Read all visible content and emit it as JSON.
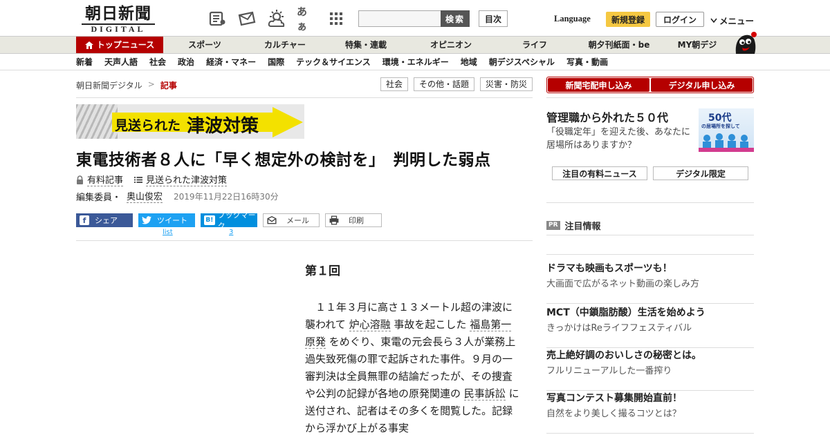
{
  "header": {
    "logo_jp": "朝日新聞",
    "logo_en": "DIGITAL",
    "icons": [
      "newspaper-icon",
      "mail-icon",
      "weather-icon",
      "font-size-icon",
      "apps-grid-icon"
    ],
    "font_size_label": "あぁ",
    "search_placeholder": "",
    "search_label": "検索",
    "toc_label": "目次",
    "language_label": "Language",
    "register_label": "新規登録",
    "login_label": "ログイン",
    "menu_label": "メニュー"
  },
  "main_nav": {
    "items": [
      {
        "label": "トップニュース",
        "active": true
      },
      {
        "label": "スポーツ"
      },
      {
        "label": "カルチャー"
      },
      {
        "label": "特集・連載"
      },
      {
        "label": "オピニオン"
      },
      {
        "label": "ライフ"
      },
      {
        "label": "朝夕刊紙面・be"
      },
      {
        "label": "MY朝デジ"
      }
    ]
  },
  "sub_nav": {
    "items": [
      "新着",
      "天声人語",
      "社会",
      "政治",
      "経済・マネー",
      "国際",
      "テック＆サイエンス",
      "環境・エネルギー",
      "地域",
      "朝デジスペシャル",
      "写真・動画"
    ]
  },
  "breadcrumb": {
    "root": "朝日新聞デジタル",
    "sep": ">",
    "current": "記事"
  },
  "category_tags": [
    "社会",
    "その他・話題",
    "災害・防災"
  ],
  "banner": {
    "text_small": "見送られた",
    "text_large": "津波対策"
  },
  "article": {
    "headline": "東電技術者８人に「早く想定外の検討を」　判明した弱点",
    "paid_label": "有料記事",
    "series_label": "見送られた津波対策",
    "author_prefix": "編集委員・",
    "author_name": "奥山俊宏",
    "date": "2019年11月22日16時30分",
    "section_heading": "第１回",
    "body_1": "　１１年３月に高さ１３メートル超の津波に襲われて",
    "body_link_1": "炉心溶融",
    "body_2": "事故を起こした",
    "body_link_2": "福島第一原発",
    "body_3": "をめぐり、東電の元会長ら３人が業務上過失致死傷の罪で起訴された事件。９月の一審判決は全員無罪の結論だったが、その捜査や公判の記録が各地の原発関連の",
    "body_link_3": "民事訴訟",
    "body_4": "に送付され、記者はその多くを閲覧した。記録から浮かび上がる事実"
  },
  "share": {
    "facebook_label": "シェア",
    "twitter_label": "ツイート",
    "twitter_count": "list",
    "hatena_label": "ブックマーク",
    "hatena_icon": "B!",
    "hatena_count": "3",
    "mail_label": "メール",
    "print_label": "印刷"
  },
  "sidebar": {
    "subscribe_paper": "新聞宅配申し込み",
    "subscribe_digital": "デジタル申し込み",
    "promo_title": "管理職から外れた５０代",
    "promo_desc": "「役職定年」を迎えた後、あなたに居場所はありますか？",
    "promo_img_big": "50代",
    "promo_img_small": "の居場所を探して",
    "tab_paid": "注目の有料ニュース",
    "tab_digital": "デジタル限定",
    "pr_badge": "PR",
    "pr_heading": "注目情報",
    "pr_items": [
      {
        "title": "ドラマも映画もスポーツも！",
        "desc": "大画面で広がるネット動画の楽しみ方"
      },
      {
        "title": "MCT（中鎖脂肪酸）生活を始めよう",
        "desc": "きっかけはReライフフェスティバル"
      },
      {
        "title": "売上絶好調のおいしさの秘密とは。",
        "desc": "フルリニューアルした一番搾り"
      },
      {
        "title": "写真コンテスト募集開始直前！",
        "desc": "自然をより美しく撮るコツとは？"
      }
    ]
  },
  "colors": {
    "brand_red": "#b50000",
    "register_yellow": "#f5c842",
    "banner_yellow": "#f3e100",
    "facebook": "#3b5998",
    "twitter": "#1da1f2",
    "hatena": "#008fde"
  }
}
